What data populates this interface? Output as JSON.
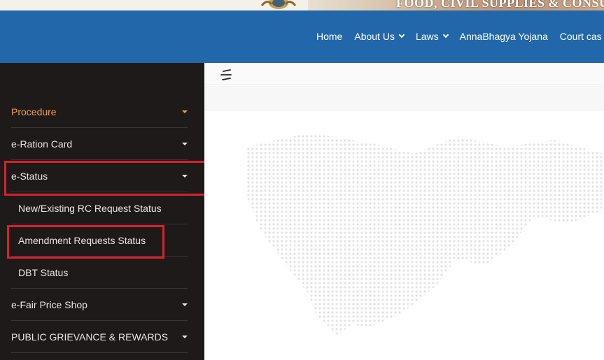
{
  "banner": {
    "title": "FOOD, CIVIL SUPPLIES & CONSU"
  },
  "nav": {
    "items": [
      {
        "label": "Home",
        "dropdown": false
      },
      {
        "label": "About Us",
        "dropdown": true
      },
      {
        "label": "Laws",
        "dropdown": true
      },
      {
        "label": "AnnaBhagya Yojana",
        "dropdown": false
      },
      {
        "label": "Court cas",
        "dropdown": false
      }
    ]
  },
  "sidebar": {
    "items": [
      {
        "label": "Procedure",
        "caret": true,
        "active": true
      },
      {
        "label": "e-Ration Card",
        "caret": true
      },
      {
        "label": "e-Status",
        "caret": true,
        "highlighted": true
      },
      {
        "label": "New/Existing RC Request Status",
        "sub": true
      },
      {
        "label": "Amendment Requests Status",
        "sub": true,
        "highlighted": true
      },
      {
        "label": "DBT Status",
        "sub": true
      },
      {
        "label": "e-Fair Price Shop",
        "caret": true
      },
      {
        "label": "PUBLIC GRIEVANCE & REWARDS",
        "caret": true
      }
    ]
  },
  "colors": {
    "nav_bg": "#2167a9",
    "sidebar_bg": "#1e1a19",
    "active_text": "#f0a43a",
    "highlight_border": "#d9212b"
  },
  "icons": {
    "toggle": "menu-toggle-icon",
    "emblem": "state-emblem-icon"
  }
}
